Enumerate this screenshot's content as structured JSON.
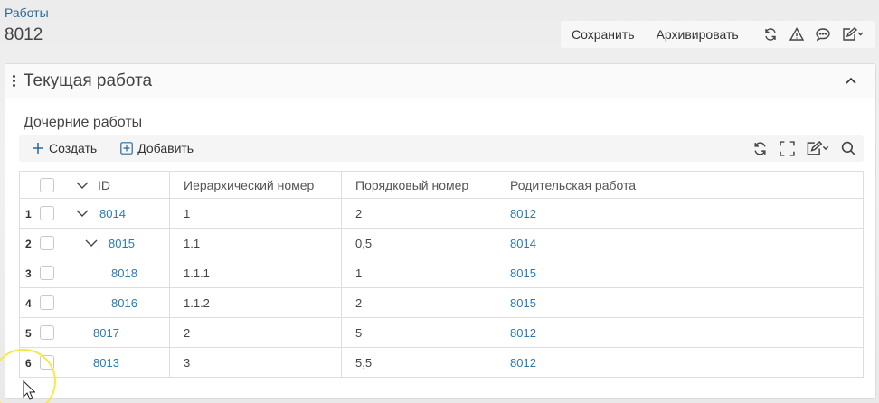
{
  "breadcrumb": {
    "label": "Работы"
  },
  "page": {
    "title": "8012"
  },
  "toolbar": {
    "save_label": "Сохранить",
    "archive_label": "Архивировать",
    "icons": [
      "refresh-icon",
      "warning-icon",
      "comment-icon",
      "edit-dropdown-icon"
    ]
  },
  "panel": {
    "title": "Текущая работа"
  },
  "section": {
    "title": "Дочерние работы"
  },
  "subtoolbar": {
    "create_label": "Создать",
    "add_label": "Добавить",
    "icons": [
      "refresh-icon",
      "fullscreen-icon",
      "edit-dropdown-icon",
      "search-icon"
    ]
  },
  "table": {
    "columns": [
      "ID",
      "Иерархический номер",
      "Порядковый номер",
      "Родительская работа"
    ],
    "rows": [
      {
        "num": "1",
        "id": "8014",
        "hier": "1",
        "order": "2",
        "parent": "8012",
        "level": 0,
        "expanded": true
      },
      {
        "num": "2",
        "id": "8015",
        "hier": "1.1",
        "order": "0,5",
        "parent": "8014",
        "level": 1,
        "expanded": true
      },
      {
        "num": "3",
        "id": "8018",
        "hier": "1.1.1",
        "order": "1",
        "parent": "8015",
        "level": 2,
        "expanded": false
      },
      {
        "num": "4",
        "id": "8016",
        "hier": "1.1.2",
        "order": "2",
        "parent": "8015",
        "level": 2,
        "expanded": false
      },
      {
        "num": "5",
        "id": "8017",
        "hier": "2",
        "order": "5",
        "parent": "8012",
        "level": 0,
        "expanded": false
      },
      {
        "num": "6",
        "id": "8013",
        "hier": "3",
        "order": "5,5",
        "parent": "8012",
        "level": 0,
        "expanded": false
      }
    ]
  },
  "colors": {
    "link": "#2a7ab0",
    "cursor_highlight": "#f3ea4a"
  }
}
